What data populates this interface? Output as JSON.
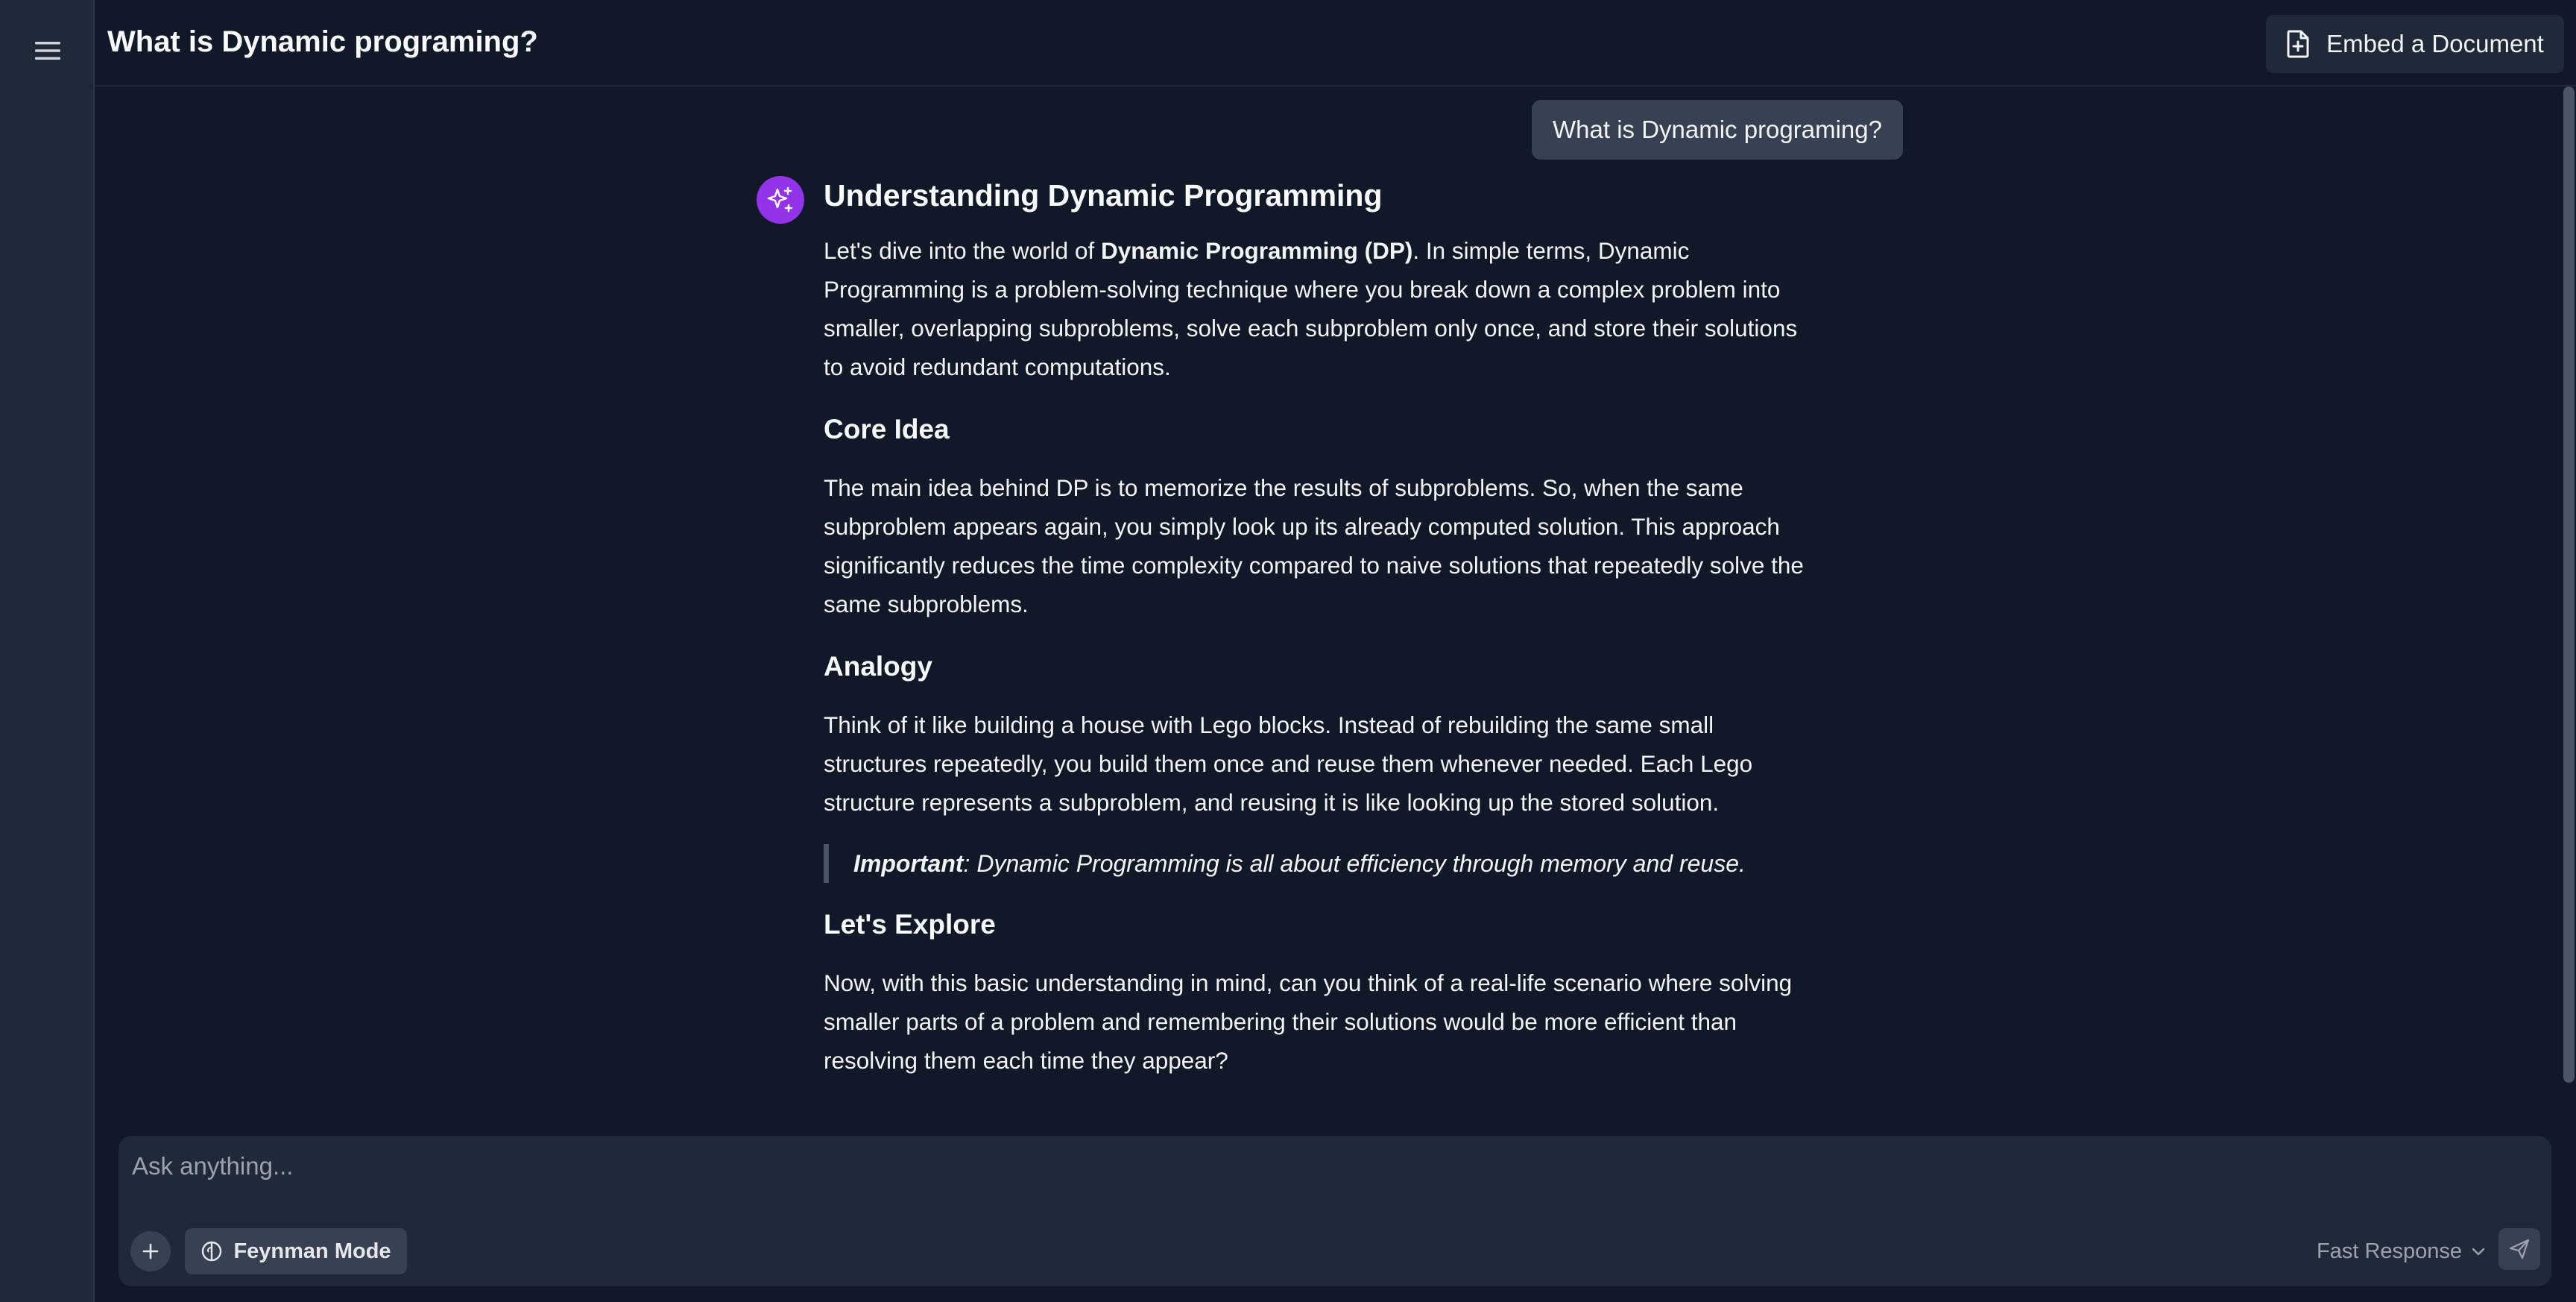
{
  "header": {
    "title": "What is Dynamic programing?",
    "embed_label": "Embed a Document"
  },
  "sidebar": {
    "menu_icon": "hamburger-menu-icon"
  },
  "chat": {
    "user_message": "What is Dynamic programing?",
    "answer": {
      "title": "Understanding Dynamic Programming",
      "intro_prefix": "Let's dive into the world of ",
      "intro_bold": "Dynamic Programming (DP)",
      "intro_suffix": ". In simple terms, Dynamic Programming is a problem-solving technique where you break down a complex problem into smaller, overlapping subproblems, solve each subproblem only once, and store their solutions to avoid redundant computations.",
      "sections": [
        {
          "heading": "Core Idea",
          "body": "The main idea behind DP is to memorize the results of subproblems. So, when the same subproblem appears again, you simply look up its already computed solution. This approach significantly reduces the time complexity compared to naive solutions that repeatedly solve the same subproblems."
        },
        {
          "heading": "Analogy",
          "body": "Think of it like building a house with Lego blocks. Instead of rebuilding the same small structures repeatedly, you build them once and reuse them whenever needed. Each Lego structure represents a subproblem, and reusing it is like looking up the stored solution."
        },
        {
          "heading": "Let's Explore",
          "body": "Now, with this basic understanding in mind, can you think of a real-life scenario where solving smaller parts of a problem and remembering their solutions would be more efficient than resolving them each time they appear?"
        }
      ],
      "quote_bold": "Important",
      "quote_rest": ": Dynamic Programming is all about efficiency through memory and reuse."
    }
  },
  "composer": {
    "placeholder": "Ask anything...",
    "mode_label": "Feynman Mode",
    "model_label": "Fast Response"
  },
  "colors": {
    "background": "#111827",
    "panel": "#1f2937",
    "button": "#374151",
    "accent": "#9333ea"
  }
}
